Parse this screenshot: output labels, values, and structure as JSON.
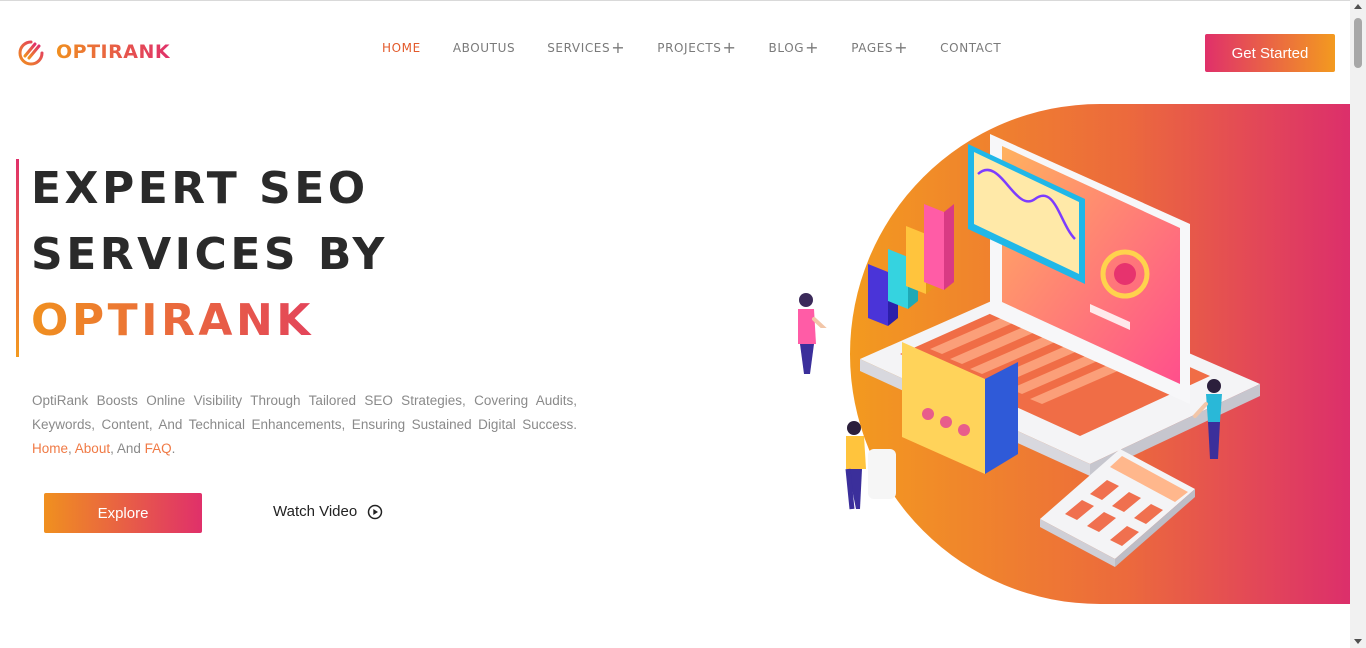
{
  "header": {
    "logo_text": "OPTIRANK",
    "nav": [
      {
        "label": "HOME",
        "active": true,
        "has_submenu": false
      },
      {
        "label": "ABOUTUS",
        "active": false,
        "has_submenu": false
      },
      {
        "label": "SERVICES",
        "active": false,
        "has_submenu": true
      },
      {
        "label": "PROJECTS",
        "active": false,
        "has_submenu": true
      },
      {
        "label": "BLOG",
        "active": false,
        "has_submenu": true
      },
      {
        "label": "PAGES",
        "active": false,
        "has_submenu": true
      },
      {
        "label": "CONTACT",
        "active": false,
        "has_submenu": false
      }
    ],
    "submenu_symbol": "+",
    "cta_label": "Get Started"
  },
  "hero": {
    "title_line1": "EXPERT SEO",
    "title_line2": "SERVICES BY",
    "title_line3": "OPTIRANK",
    "description": "OptiRank Boosts Online Visibility Through Tailored SEO Strategies, Covering Audits, Keywords, Content, And Technical Enhancements, Ensuring Sustained Digital Success.",
    "link_home": "Home",
    "link_about": "About",
    "link_and": "And",
    "link_faq": "FAQ",
    "explore_label": "Explore",
    "watch_label": "Watch Video",
    "watch_icon": "play-circle-icon"
  },
  "colors": {
    "brand_orange": "#f39a1f",
    "brand_pink": "#e0306a",
    "nav_active": "#e35b2c",
    "nav_text": "#7a7a7a",
    "body_text": "#8a8a8a",
    "heading_text": "#2a2a2a"
  }
}
